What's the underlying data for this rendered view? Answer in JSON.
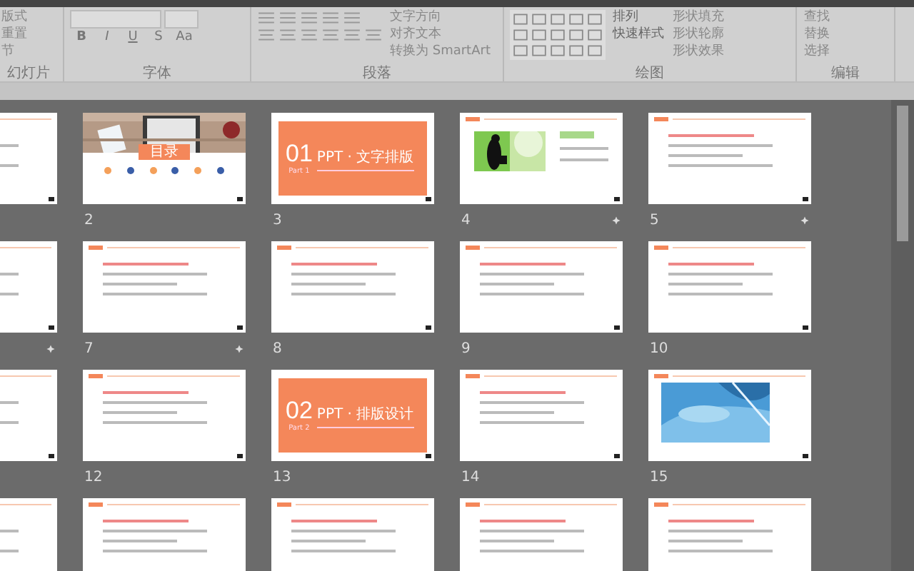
{
  "ribbon": {
    "groups": [
      {
        "kind": "slides",
        "label": "幻灯片",
        "buttons": [
          "版式",
          "重置",
          "节"
        ]
      },
      {
        "kind": "font",
        "label": "字体",
        "buttons": [
          "B",
          "I",
          "U",
          "S",
          "Aa"
        ]
      },
      {
        "kind": "paragraph",
        "label": "段落",
        "buttons": [
          "文字方向",
          "对齐文本",
          "转换为 SmartArt"
        ]
      },
      {
        "kind": "drawing",
        "label": "绘图",
        "buttons": [
          "排列",
          "快速样式",
          "形状填充",
          "形状轮廓",
          "形状效果"
        ]
      },
      {
        "kind": "editing",
        "label": "编辑",
        "buttons": [
          "查找",
          "替换",
          "选择"
        ]
      }
    ]
  },
  "slides": [
    {
      "kind": "content",
      "animated": false
    },
    {
      "kind": "photo-title",
      "number": "2",
      "heading": "目录",
      "animated": false
    },
    {
      "kind": "section",
      "number": "3",
      "big": "01",
      "title": "PPT · 文字排版",
      "part": "Part 1",
      "animated": false
    },
    {
      "kind": "picture-left",
      "number": "4",
      "animated": true
    },
    {
      "kind": "content",
      "number": "5",
      "animated": true
    },
    {
      "kind": "content",
      "animated": true
    },
    {
      "kind": "content",
      "number": "7",
      "animated": true
    },
    {
      "kind": "content",
      "number": "8",
      "animated": false
    },
    {
      "kind": "content",
      "number": "9",
      "animated": false
    },
    {
      "kind": "content",
      "number": "10",
      "animated": false
    },
    {
      "kind": "content",
      "animated": false
    },
    {
      "kind": "content",
      "number": "12",
      "animated": false
    },
    {
      "kind": "section",
      "number": "13",
      "big": "02",
      "title": "PPT · 排版设计",
      "part": "Part 2",
      "animated": false
    },
    {
      "kind": "content",
      "number": "14",
      "animated": false
    },
    {
      "kind": "picture-center",
      "number": "15",
      "animated": false
    },
    {
      "kind": "content"
    },
    {
      "kind": "content"
    },
    {
      "kind": "content"
    },
    {
      "kind": "content"
    },
    {
      "kind": "content"
    }
  ]
}
